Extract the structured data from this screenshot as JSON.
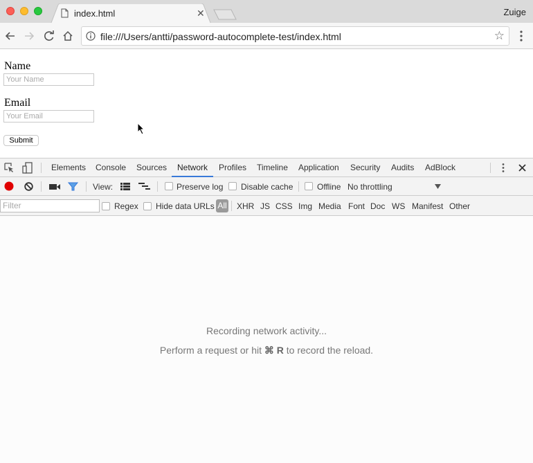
{
  "browser": {
    "tab_title": "index.html",
    "profile_name": "Zuige",
    "url": "file:///Users/antti/password-autocomplete-test/index.html"
  },
  "page": {
    "name_label": "Name",
    "name_placeholder": "Your Name",
    "name_value": "",
    "email_label": "Email",
    "email_placeholder": "Your Email",
    "email_value": "",
    "submit_label": "Submit"
  },
  "devtools": {
    "tabs": [
      "Elements",
      "Console",
      "Sources",
      "Network",
      "Profiles",
      "Timeline",
      "Application",
      "Security",
      "Audits",
      "AdBlock"
    ],
    "active_tab": "Network",
    "toolbar": {
      "view_label": "View:",
      "preserve_log_label": "Preserve log",
      "preserve_log_checked": false,
      "disable_cache_label": "Disable cache",
      "disable_cache_checked": false,
      "offline_label": "Offline",
      "offline_checked": false,
      "throttling_value": "No throttling"
    },
    "filter_bar": {
      "filter_placeholder": "Filter",
      "regex_label": "Regex",
      "hide_data_urls_label": "Hide data URLs",
      "types": [
        "All",
        "XHR",
        "JS",
        "CSS",
        "Img",
        "Media",
        "Font",
        "Doc",
        "WS",
        "Manifest",
        "Other"
      ],
      "active_type": "All"
    },
    "empty_state": {
      "line1": "Recording network activity...",
      "line2_prefix": "Perform a request or hit ",
      "line2_shortcut": "⌘ R",
      "line2_suffix": " to record the reload."
    },
    "colors": {
      "record_active": "#e00000",
      "filter_active": "#3879d9",
      "tab_underline": "#3879d9"
    }
  }
}
